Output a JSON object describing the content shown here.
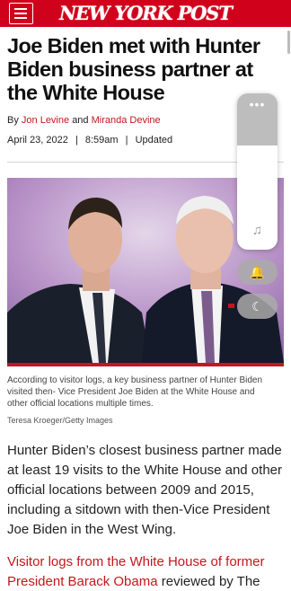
{
  "header": {
    "logo": "NEW YORK POST",
    "brand_color": "#d0021b",
    "menu_icon": "hamburger-menu-icon"
  },
  "article": {
    "headline": "Joe Biden met with Hunter Biden business partner at the White House",
    "byline_prefix": "By",
    "author1": "Jon Levine",
    "byline_and": "and",
    "author2": "Miranda Devine",
    "date": "April 23, 2022",
    "separator": "|",
    "time": "8:59am",
    "updated": "Updated",
    "caption": "According to visitor logs, a key business partner of Hunter Biden visited then- Vice President Joe Biden at the White House and other official locations multiple times.",
    "credit": "Teresa Kroeger/Getty Images",
    "paragraph1": "Hunter Biden’s closest business partner made at least 19 visits to the White House and other official locations between 2009 and 2015, including a sitdown with then-Vice President Joe Biden in the West Wing.",
    "paragraph2_link": "Visitor logs from the White House of former President Barack Obama",
    "paragraph2_rest": " reviewed by The Post"
  },
  "overlay": {
    "more_glyph": "•••",
    "music_glyph": "♫",
    "bell_glyph": "🔔",
    "moon_glyph": "☾"
  },
  "link_color": "#c4161c"
}
